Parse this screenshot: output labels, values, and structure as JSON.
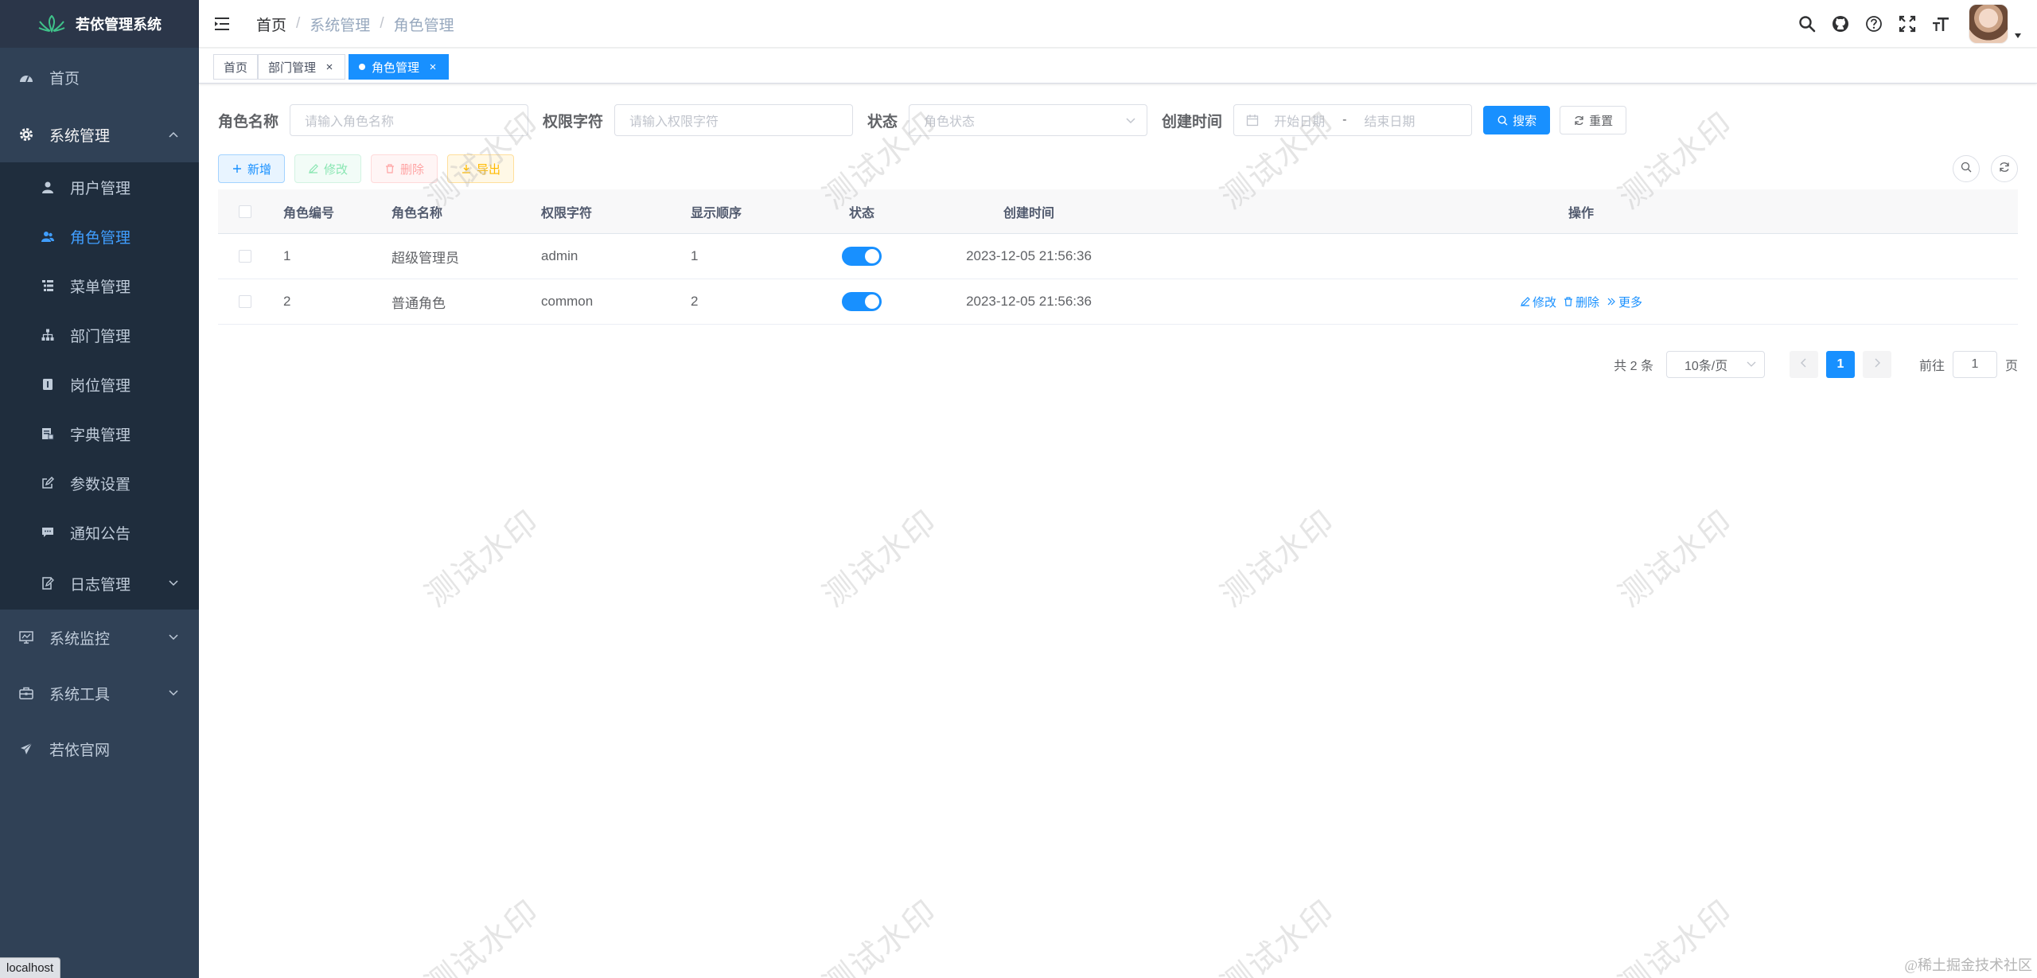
{
  "app": {
    "title": "若依管理系统"
  },
  "sidebar": {
    "items": [
      {
        "label": "首页",
        "icon": "dashboard-icon"
      },
      {
        "label": "系统管理",
        "icon": "gear-icon",
        "expanded": true,
        "children": [
          {
            "label": "用户管理",
            "icon": "user-icon"
          },
          {
            "label": "角色管理",
            "icon": "peoples-icon",
            "active": true
          },
          {
            "label": "菜单管理",
            "icon": "tree-table-icon"
          },
          {
            "label": "部门管理",
            "icon": "tree-icon"
          },
          {
            "label": "岗位管理",
            "icon": "post-icon"
          },
          {
            "label": "字典管理",
            "icon": "dict-icon"
          },
          {
            "label": "参数设置",
            "icon": "edit-icon"
          },
          {
            "label": "通知公告",
            "icon": "message-icon"
          },
          {
            "label": "日志管理",
            "icon": "log-icon"
          }
        ]
      },
      {
        "label": "系统监控",
        "icon": "monitor-icon"
      },
      {
        "label": "系统工具",
        "icon": "tool-icon"
      },
      {
        "label": "若依官网",
        "icon": "guide-icon"
      }
    ]
  },
  "header": {
    "breadcrumb": [
      "首页",
      "系统管理",
      "角色管理"
    ],
    "icons": [
      "search-icon",
      "github-icon",
      "question-icon",
      "fullscreen-icon",
      "font-size-icon"
    ]
  },
  "tags": [
    {
      "label": "首页",
      "closable": false
    },
    {
      "label": "部门管理",
      "closable": true
    },
    {
      "label": "角色管理",
      "closable": true,
      "active": true
    }
  ],
  "filters": {
    "role_name": {
      "label": "角色名称",
      "placeholder": "请输入角色名称"
    },
    "role_key": {
      "label": "权限字符",
      "placeholder": "请输入权限字符"
    },
    "status": {
      "label": "状态",
      "placeholder": "角色状态"
    },
    "created": {
      "label": "创建时间",
      "start": "开始日期",
      "separator": "-",
      "end": "结束日期"
    },
    "search_label": "搜索",
    "reset_label": "重置"
  },
  "toolbar": {
    "add_label": "新增",
    "edit_label": "修改",
    "delete_label": "删除",
    "export_label": "导出"
  },
  "table": {
    "columns": [
      "角色编号",
      "角色名称",
      "权限字符",
      "显示顺序",
      "状态",
      "创建时间",
      "操作"
    ],
    "rows": [
      {
        "id": "1",
        "name": "超级管理员",
        "key": "admin",
        "sort": "1",
        "status_on": true,
        "created": "2023-12-05 21:56:36",
        "ops": []
      },
      {
        "id": "2",
        "name": "普通角色",
        "key": "common",
        "sort": "2",
        "status_on": true,
        "created": "2023-12-05 21:56:36",
        "ops": [
          "修改",
          "删除",
          "更多"
        ]
      }
    ]
  },
  "pagination": {
    "total_text": "共 2 条",
    "page_size": "10条/页",
    "current_page": "1",
    "jump_prefix": "前往",
    "jump_value": "1",
    "jump_suffix": "页"
  },
  "watermark": "测试水印",
  "footer_watermark": "@稀土掘金技术社区",
  "status_chip": "localhost",
  "colors": {
    "primary": "#1890ff",
    "sidebar_bg": "#304156",
    "submenu_bg": "#1f2d3d",
    "tag_active": "#42b983"
  }
}
